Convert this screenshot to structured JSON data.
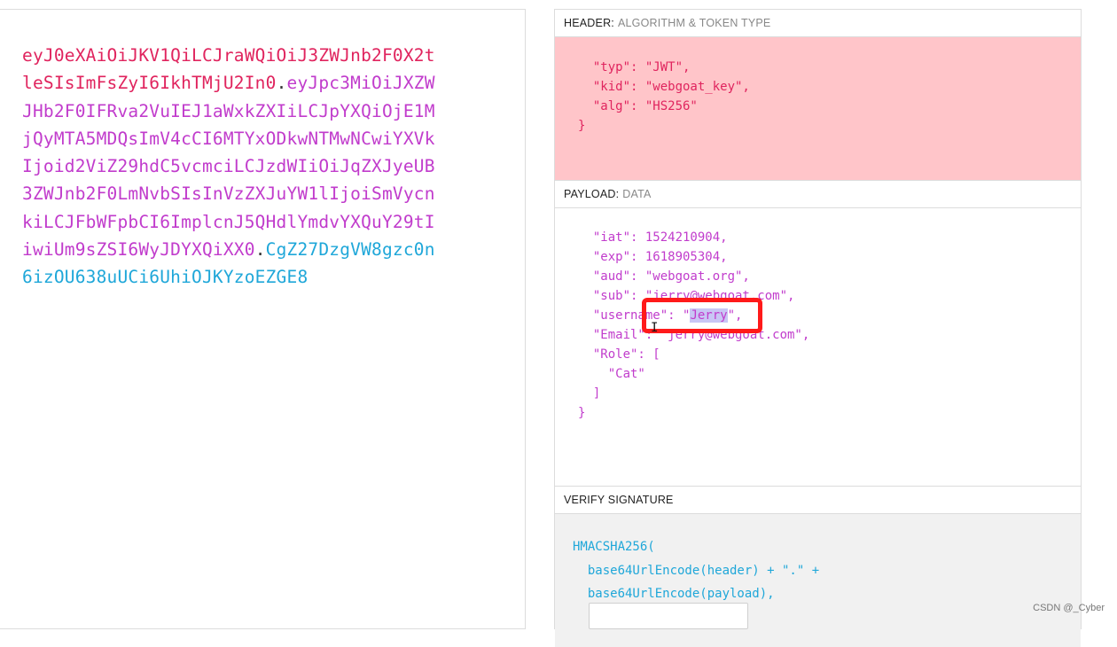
{
  "encoded": {
    "header_lines": [
      "eyJ0eXAiOiJKV1QiLCJraWQiOiJ3ZWJnb2F0X2t",
      "leSIsImFsZyI6IkhTMjU2In0"
    ],
    "payload_first": "eyJpc3MiOiJXZW",
    "payload_lines": [
      "JHb2F0IFRva2VuIEJ1aWxkZXIiLCJpYXQiOjE1M",
      "jQyMTA5MDQsImV4cCI6MTYxODkwNTMwNCwiYXVk",
      "Ijoid2ViZ29hdC5vcmciLCJzdWIiOiJqZXJyeUB",
      "3ZWJnb2F0LmNvbSIsInVzZXJuYW1lIjoiSmVycn",
      "kiLCJFbWFpbCI6ImplcnJ5QHdlYmdvYXQuY29tI"
    ],
    "payload_last": "iwiUm9sZSI6WyJDYXQiXX0",
    "signature_first": "CgZ27DzgVW8gzc0n",
    "signature_last": "6izOU638uUCi6UhiOJKYzoEZGE8",
    "dot": "."
  },
  "header": {
    "title": "HEADER:",
    "subtitle": "ALGORITHM & TOKEN TYPE",
    "code": "  \"typ\": \"JWT\",\n  \"kid\": \"webgoat_key\",\n  \"alg\": \"HS256\"\n}"
  },
  "payload": {
    "title": "PAYLOAD:",
    "subtitle": "DATA",
    "code_before": "  \"iat\": 1524210904,\n  \"exp\": 1618905304,\n  \"aud\": \"webgoat.org\",\n  \"sub\": \"jerry@webgoat.com\",\n  \"username\": \"",
    "highlighted": "Jerry",
    "code_after": "\",\n  \"Email\": \"jerry@webgoat.com\",\n  \"Role\": [\n    \"Cat\"\n  ]\n}"
  },
  "verify": {
    "title": "VERIFY SIGNATURE",
    "code": "HMACSHA256(\n  base64UrlEncode(header) + \".\" +\n  base64UrlEncode(payload),"
  },
  "cursor_glyph": "I",
  "watermark": "CSDN @_Cyber",
  "colors": {
    "header": "#e0245e",
    "payload": "#c13ccc",
    "signature": "#1fa7d9",
    "header_bg": "#ffc5c9",
    "highlight_box": "#ff1a1a"
  }
}
